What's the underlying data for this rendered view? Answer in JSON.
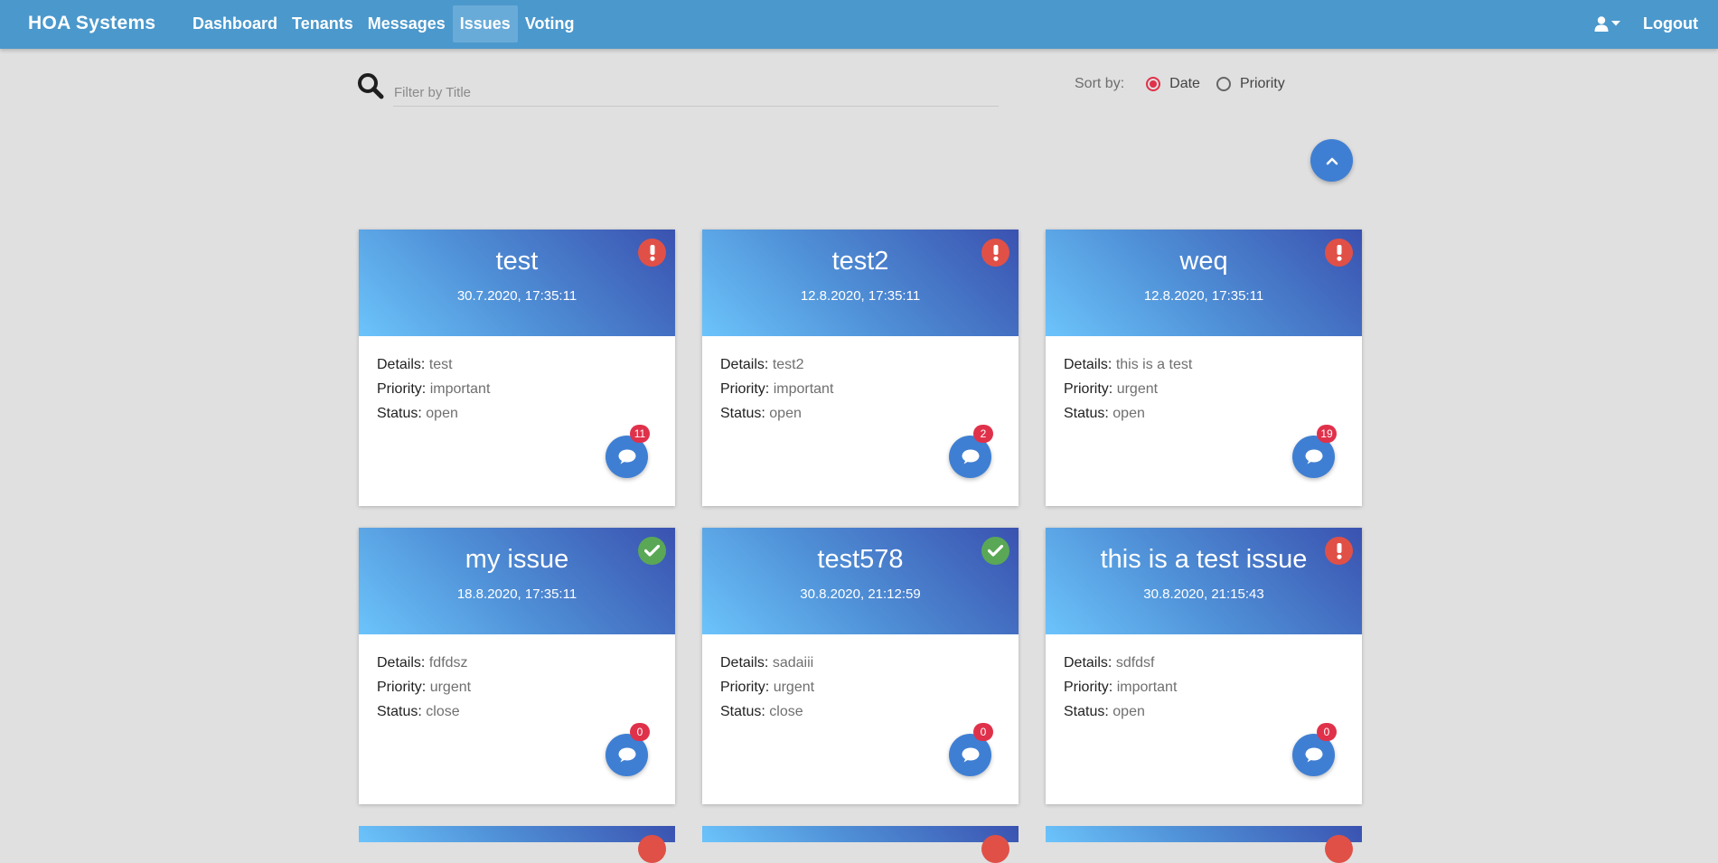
{
  "navbar": {
    "brand": "HOA Systems",
    "links": [
      {
        "label": "Dashboard",
        "active": false
      },
      {
        "label": "Tenants",
        "active": false
      },
      {
        "label": "Messages",
        "active": false
      },
      {
        "label": "Issues",
        "active": true
      },
      {
        "label": "Voting",
        "active": false
      }
    ],
    "user_icon": "user-icon",
    "logout_label": "Logout"
  },
  "search": {
    "placeholder": "Filter by Title",
    "value": "",
    "icon": "search-icon"
  },
  "sort": {
    "label": "Sort by:",
    "options": [
      {
        "label": "Date",
        "checked": true
      },
      {
        "label": "Priority",
        "checked": false
      }
    ]
  },
  "scroll_button": {
    "icon": "chevron-up-icon"
  },
  "labels": {
    "details": "Details:",
    "priority": "Priority:",
    "status": "Status:"
  },
  "colors": {
    "navbar": "#4b98cc",
    "accent": "#3f7fd3",
    "badge": "#e0314b",
    "status_open": "#e05047",
    "status_closed": "#5aa856"
  },
  "issues": [
    {
      "title": "test",
      "date": "30.7.2020, 17:35:11",
      "details": "test",
      "priority": "important",
      "status": "open",
      "comments": "11",
      "status_icon": "exclamation-icon"
    },
    {
      "title": "test2",
      "date": "12.8.2020, 17:35:11",
      "details": "test2",
      "priority": "important",
      "status": "open",
      "comments": "2",
      "status_icon": "exclamation-icon"
    },
    {
      "title": "weq",
      "date": "12.8.2020, 17:35:11",
      "details": "this is a test",
      "priority": "urgent",
      "status": "open",
      "comments": "19",
      "status_icon": "exclamation-icon"
    },
    {
      "title": "my issue",
      "date": "18.8.2020, 17:35:11",
      "details": "fdfdsz",
      "priority": "urgent",
      "status": "close",
      "comments": "0",
      "status_icon": "check-icon"
    },
    {
      "title": "test578",
      "date": "30.8.2020, 21:12:59",
      "details": "sadaiii",
      "priority": "urgent",
      "status": "close",
      "comments": "0",
      "status_icon": "check-icon"
    },
    {
      "title": "this is a test issue",
      "date": "30.8.2020, 21:15:43",
      "details": "sdfdsf",
      "priority": "important",
      "status": "open",
      "comments": "0",
      "status_icon": "exclamation-icon"
    }
  ]
}
